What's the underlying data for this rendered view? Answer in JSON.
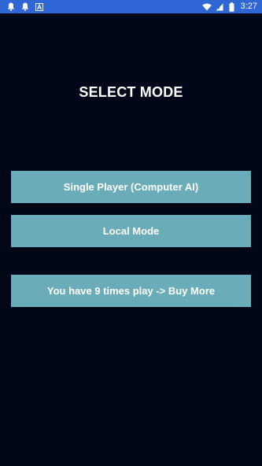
{
  "status_bar": {
    "time": "3:27",
    "icons_left": [
      "notification-bell-icon",
      "notification-bell-icon",
      "app-a-icon"
    ],
    "icons_right": [
      "wifi-icon",
      "cell-signal-icon",
      "battery-icon"
    ]
  },
  "screen": {
    "title": "SELECT MODE",
    "buttons": {
      "single_player": "Single Player (Computer AI)",
      "local_mode": "Local Mode",
      "buy_more": "You have 9 times play -> Buy More"
    }
  },
  "colors": {
    "background": "#020718",
    "status_bar": "#2f66d6",
    "button": "#6aacb7",
    "text": "#ffffff"
  }
}
